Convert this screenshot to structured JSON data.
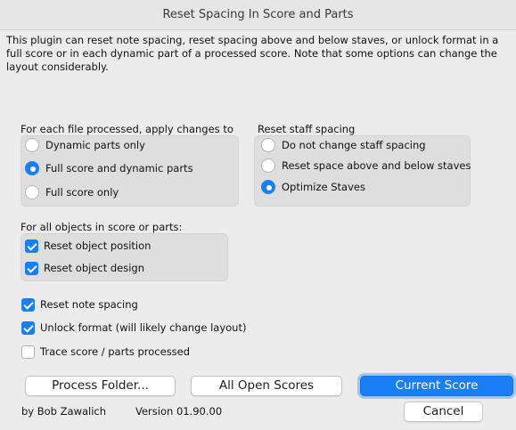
{
  "window": {
    "title": "Reset Spacing In Score and Parts"
  },
  "description": "This plugin can reset note spacing, reset spacing above and below staves, or unlock format in a full score or in each dynamic part of a processed score. Note that some options can change the layout considerably.",
  "apply_group": {
    "label": "For each file processed, apply changes to",
    "options": [
      {
        "label": "Dynamic parts only",
        "selected": false
      },
      {
        "label": "Full score and dynamic parts",
        "selected": true
      },
      {
        "label": "Full score only",
        "selected": false
      }
    ]
  },
  "staff_group": {
    "label": "Reset staff spacing",
    "options": [
      {
        "label": "Do not change staff spacing",
        "selected": false
      },
      {
        "label": "Reset space above and below staves",
        "selected": false
      },
      {
        "label": "Optimize Staves",
        "selected": true
      }
    ]
  },
  "objects_group": {
    "label": "For all objects in score or parts:",
    "options": [
      {
        "label": "Reset object position",
        "checked": true
      },
      {
        "label": "Reset object design",
        "checked": true
      }
    ]
  },
  "options": [
    {
      "label": "Reset note spacing",
      "checked": true
    },
    {
      "label": "Unlock format (will likely change layout)",
      "checked": true
    },
    {
      "label": "Trace score / parts processed",
      "checked": false
    }
  ],
  "buttons": {
    "process_folder": "Process Folder...",
    "all_open_scores": "All Open Scores",
    "current_score": "Current Score",
    "cancel": "Cancel"
  },
  "footer": {
    "author": "by Bob Zawalich",
    "version": "Version 01.90.00"
  },
  "colors": {
    "accent": "#1a7ff5"
  }
}
